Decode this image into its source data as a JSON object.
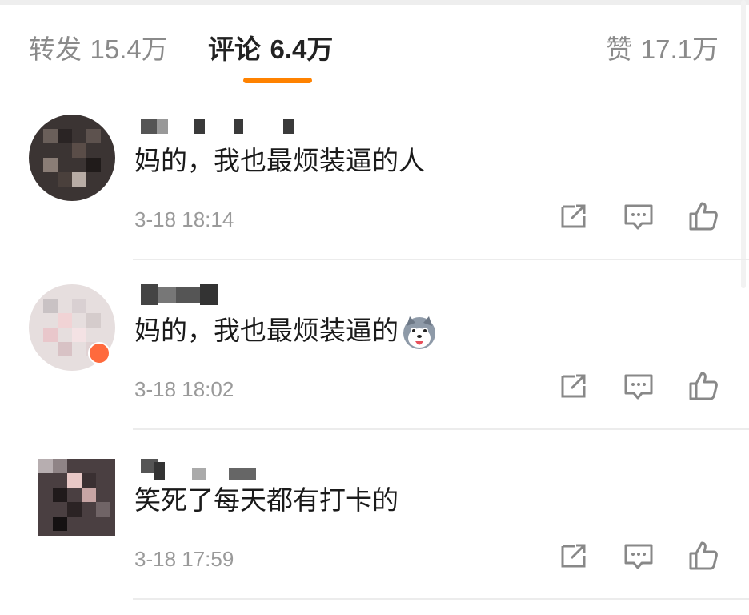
{
  "tabs": {
    "repost": {
      "label": "转发",
      "count": "15.4万"
    },
    "comments": {
      "label": "评论",
      "count": "6.4万"
    },
    "likes": {
      "label": "赞",
      "count": "17.1万"
    }
  },
  "accent_color": "#ff8200",
  "comments": [
    {
      "text": "妈的，我也最烦装逼的人",
      "time": "3-18 18:14"
    },
    {
      "text": "妈的，我也最烦装逼的",
      "emoji": "husky-dog-emoji",
      "time": "3-18 18:02"
    },
    {
      "text": "笑死了每天都有打卡的",
      "time": "3-18 17:59"
    }
  ],
  "actions": {
    "share": "share-icon",
    "reply": "comment-icon",
    "like": "thumbs-up-icon"
  }
}
